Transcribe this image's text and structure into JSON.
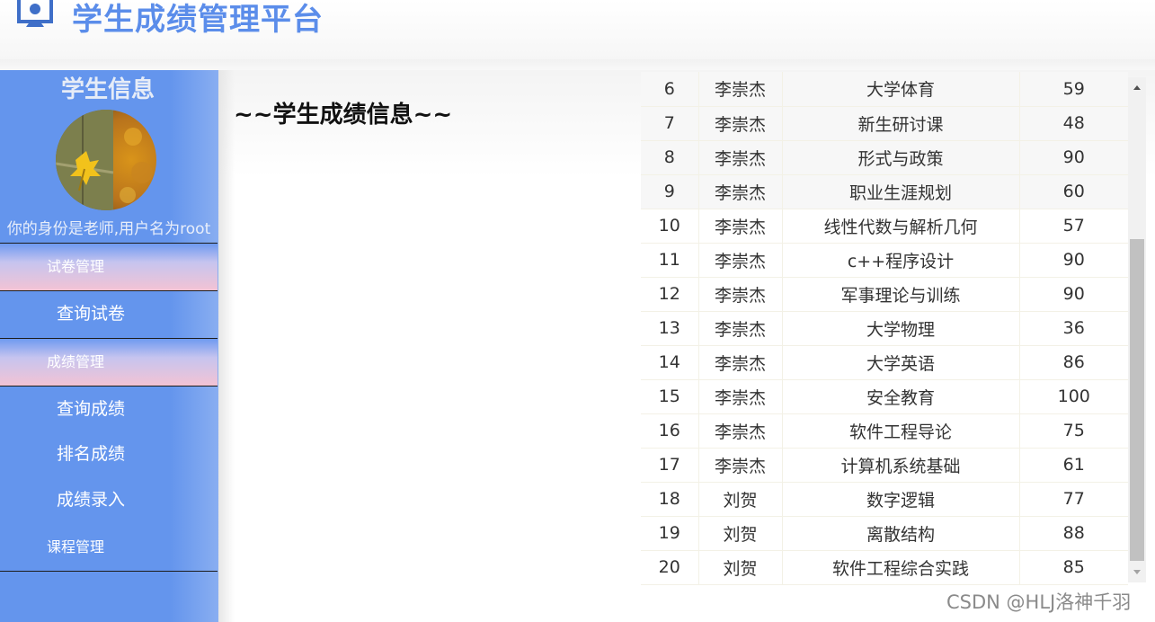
{
  "header": {
    "title": "学生成绩管理平台",
    "logo_icon": "person-board-icon"
  },
  "sidebar": {
    "title": "学生信息",
    "identity": "你的身份是老师,用户名为root",
    "sections": [
      {
        "label": "试卷管理",
        "items": [
          {
            "label": "查询试卷"
          }
        ]
      },
      {
        "label": "成绩管理",
        "items": [
          {
            "label": "查询成绩"
          },
          {
            "label": "排名成绩"
          },
          {
            "label": "成绩录入"
          }
        ]
      },
      {
        "label": "课程管理",
        "items": []
      }
    ]
  },
  "main": {
    "heading": "~~学生成绩信息~~",
    "rows": [
      {
        "id": "6",
        "name": "李崇杰",
        "course": "大学体育",
        "score": "59"
      },
      {
        "id": "7",
        "name": "李崇杰",
        "course": "新生研讨课",
        "score": "48"
      },
      {
        "id": "8",
        "name": "李崇杰",
        "course": "形式与政策",
        "score": "90"
      },
      {
        "id": "9",
        "name": "李崇杰",
        "course": "职业生涯规划",
        "score": "60"
      },
      {
        "id": "10",
        "name": "李崇杰",
        "course": "线性代数与解析几何",
        "score": "57"
      },
      {
        "id": "11",
        "name": "李崇杰",
        "course": "c++程序设计",
        "score": "90"
      },
      {
        "id": "12",
        "name": "李崇杰",
        "course": "军事理论与训练",
        "score": "90"
      },
      {
        "id": "13",
        "name": "李崇杰",
        "course": "大学物理",
        "score": "36"
      },
      {
        "id": "14",
        "name": "李崇杰",
        "course": "大学英语",
        "score": "86"
      },
      {
        "id": "15",
        "name": "李崇杰",
        "course": "安全教育",
        "score": "100"
      },
      {
        "id": "16",
        "name": "李崇杰",
        "course": "软件工程导论",
        "score": "75"
      },
      {
        "id": "17",
        "name": "李崇杰",
        "course": "计算机系统基础",
        "score": "61"
      },
      {
        "id": "18",
        "name": "刘贺",
        "course": "数字逻辑",
        "score": "77"
      },
      {
        "id": "19",
        "name": "刘贺",
        "course": "离散结构",
        "score": "88"
      },
      {
        "id": "20",
        "name": "刘贺",
        "course": "软件工程综合实践",
        "score": "85"
      }
    ]
  },
  "watermark": "CSDN @HLJ洛神千羽",
  "colors": {
    "accent": "#6495ed",
    "title": "#5b8dea",
    "section_pink": "#f3c3d4"
  }
}
